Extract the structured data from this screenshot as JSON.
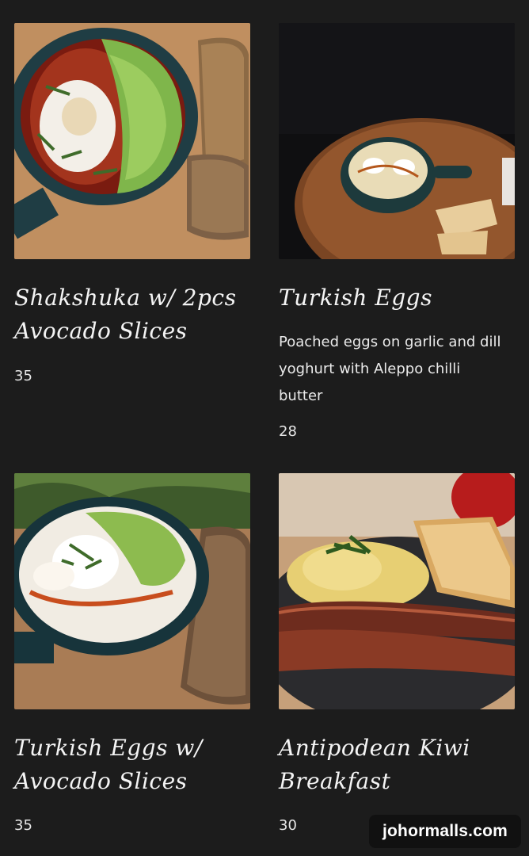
{
  "items": [
    {
      "title_line1": "Shakshuka w/ 2pcs",
      "title_line2": "Avocado Slices",
      "description": "",
      "price": "35",
      "image_icon": "shakshuka-photo"
    },
    {
      "title_line1": "Turkish Eggs",
      "title_line2": "",
      "description_lines": [
        "Poached eggs on garlic and dill",
        "yoghurt with Aleppo chilli",
        "butter"
      ],
      "price": "28",
      "image_icon": "turkish-eggs-photo"
    },
    {
      "title_line1": "Turkish Eggs w/",
      "title_line2": "Avocado Slices",
      "description": "",
      "price": "35",
      "image_icon": "turkish-eggs-avocado-photo"
    },
    {
      "title_line1": "Antipodean Kiwi",
      "title_line2": "Breakfast",
      "description": "",
      "price": "30",
      "image_icon": "kiwi-breakfast-photo"
    }
  ],
  "watermark": "johormalls.com",
  "colors": {
    "background": "#1c1c1c",
    "text": "#f2f2f2"
  }
}
